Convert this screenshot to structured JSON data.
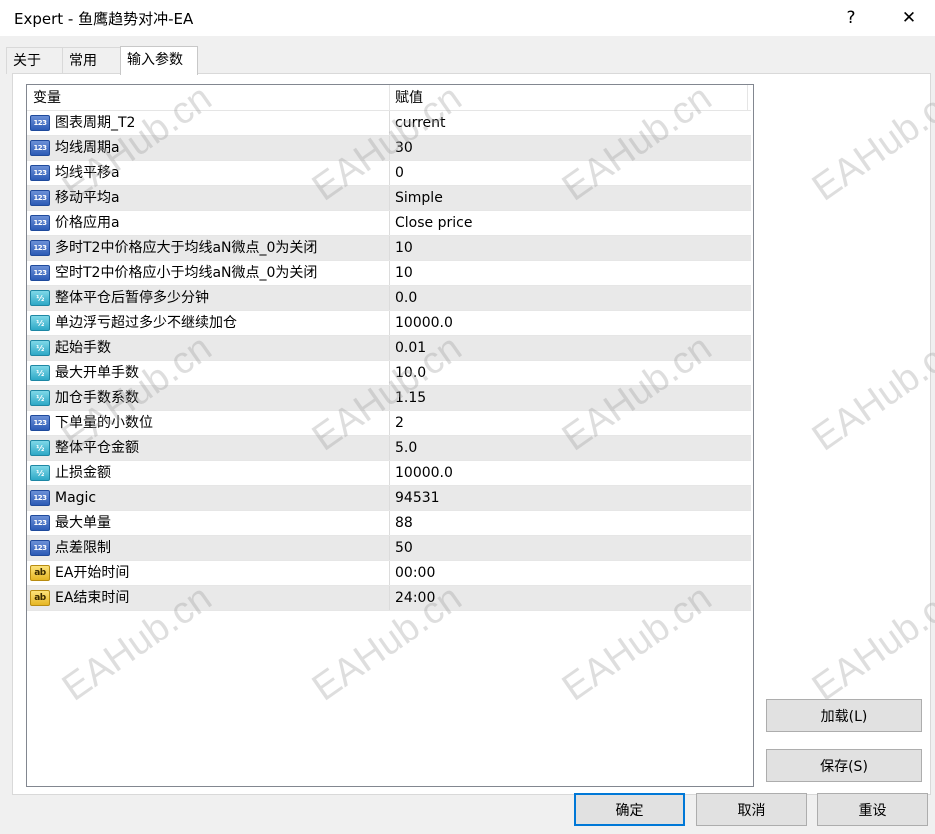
{
  "window": {
    "title": "Expert - 鱼鹰趋势对冲-EA",
    "help_label": "?",
    "close_label": "✕"
  },
  "tabs": [
    {
      "label": "关于",
      "active": false
    },
    {
      "label": "常用",
      "active": false
    },
    {
      "label": "输入参数",
      "active": true
    }
  ],
  "grid": {
    "headers": {
      "variable": "变量",
      "value": "赋值"
    },
    "rows": [
      {
        "type": "int",
        "icon": "123",
        "name": "图表周期_T2",
        "value": "current"
      },
      {
        "type": "int",
        "icon": "123",
        "name": "均线周期a",
        "value": "30"
      },
      {
        "type": "int",
        "icon": "123",
        "name": "均线平移a",
        "value": "0"
      },
      {
        "type": "int",
        "icon": "123",
        "name": "移动平均a",
        "value": "Simple"
      },
      {
        "type": "int",
        "icon": "123",
        "name": "价格应用a",
        "value": "Close price"
      },
      {
        "type": "int",
        "icon": "123",
        "name": "多时T2中价格应大于均线aN微点_0为关闭",
        "value": "10"
      },
      {
        "type": "int",
        "icon": "123",
        "name": "空时T2中价格应小于均线aN微点_0为关闭",
        "value": "10"
      },
      {
        "type": "double",
        "icon": "½",
        "name": "整体平仓后暂停多少分钟",
        "value": "0.0"
      },
      {
        "type": "double",
        "icon": "½",
        "name": "单边浮亏超过多少不继续加仓",
        "value": "10000.0"
      },
      {
        "type": "double",
        "icon": "½",
        "name": "起始手数",
        "value": "0.01"
      },
      {
        "type": "double",
        "icon": "½",
        "name": "最大开单手数",
        "value": "10.0"
      },
      {
        "type": "double",
        "icon": "½",
        "name": "加仓手数系数",
        "value": "1.15"
      },
      {
        "type": "int",
        "icon": "123",
        "name": "下单量的小数位",
        "value": "2"
      },
      {
        "type": "double",
        "icon": "½",
        "name": "整体平仓金额",
        "value": "5.0"
      },
      {
        "type": "double",
        "icon": "½",
        "name": "止损金额",
        "value": "10000.0"
      },
      {
        "type": "int",
        "icon": "123",
        "name": "Magic",
        "value": "94531"
      },
      {
        "type": "int",
        "icon": "123",
        "name": "最大单量",
        "value": "88"
      },
      {
        "type": "int",
        "icon": "123",
        "name": "点差限制",
        "value": "50"
      },
      {
        "type": "string",
        "icon": "ab",
        "name": "EA开始时间",
        "value": "00:00"
      },
      {
        "type": "string",
        "icon": "ab",
        "name": "EA结束时间",
        "value": "24:00"
      }
    ]
  },
  "buttons": {
    "load": "加载(L)",
    "save": "保存(S)",
    "ok": "确定",
    "cancel": "取消",
    "reset": "重设"
  },
  "watermark": "EAHub.cn",
  "colors": {
    "default_button_border": "#0078d7",
    "alt_row": "#e9e9e9"
  }
}
